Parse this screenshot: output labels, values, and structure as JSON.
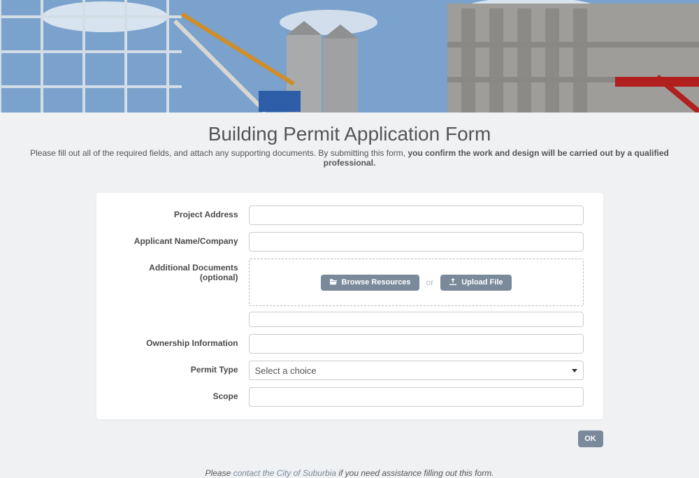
{
  "header": {
    "title": "Building Permit Application Form",
    "subtitle_prefix": "Please fill out all of the required fields, and attach any supporting documents. By submitting this form, ",
    "subtitle_bold": "you confirm the work and design will be carried out by a qualified professional."
  },
  "form": {
    "fields": {
      "project_address": {
        "label": "Project Address",
        "value": ""
      },
      "applicant_name": {
        "label": "Applicant Name/Company",
        "value": ""
      },
      "additional_docs": {
        "label": "Additional Documents (optional)",
        "browse_label": "Browse Resources",
        "or_label": "or",
        "upload_label": "Upload File"
      },
      "ownership_info": {
        "label": "Ownership Information",
        "value": ""
      },
      "permit_type": {
        "label": "Permit Type",
        "placeholder": "Select a choice",
        "value": ""
      },
      "scope": {
        "label": "Scope",
        "value": ""
      }
    },
    "submit_label": "OK"
  },
  "footer": {
    "prefix": "Please ",
    "link_text": "contact the City of Suburbia",
    "suffix": " if you need assistance filling out this form."
  }
}
